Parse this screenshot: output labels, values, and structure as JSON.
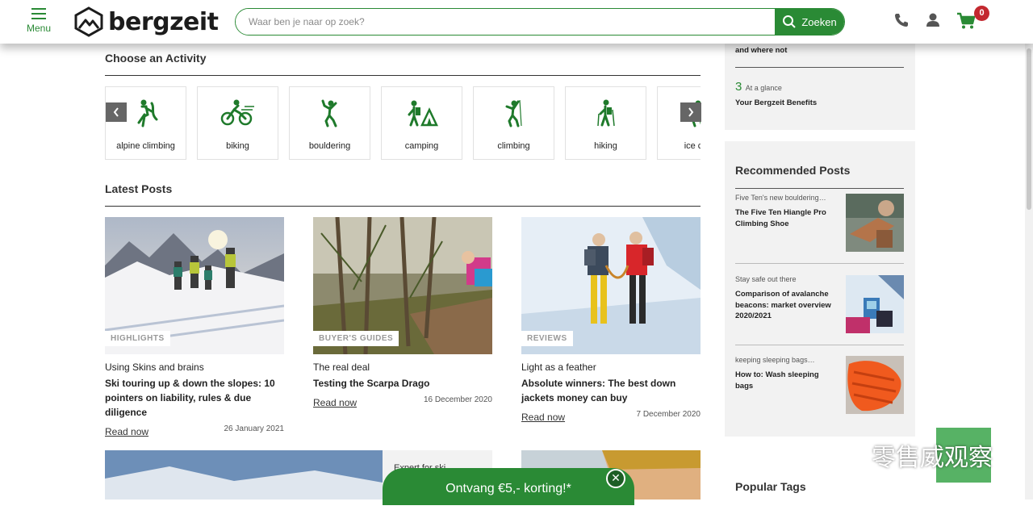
{
  "header": {
    "menu_label": "Menu",
    "logo_text": "bergzeit",
    "search_placeholder": "Waar ben je naar op zoek?",
    "search_button": "Zoeken",
    "cart_count": "0"
  },
  "activities": {
    "title": "Choose an Activity",
    "items": [
      {
        "label": "alpine climbing",
        "icon": "alpine-climbing-icon"
      },
      {
        "label": "biking",
        "icon": "biking-icon"
      },
      {
        "label": "bouldering",
        "icon": "bouldering-icon"
      },
      {
        "label": "camping",
        "icon": "camping-icon"
      },
      {
        "label": "climbing",
        "icon": "climbing-icon"
      },
      {
        "label": "hiking",
        "icon": "hiking-icon"
      },
      {
        "label": "ice clin",
        "icon": "ice-climbing-icon"
      }
    ]
  },
  "latest": {
    "title": "Latest Posts",
    "posts": [
      {
        "tag": "HIGHLIGHTS",
        "kicker": "Using Skins and brains",
        "title": "Ski touring up & down the slopes: 10 pointers on liability, rules & due diligence",
        "read": "Read now",
        "date": "26 January 2021"
      },
      {
        "tag": "BUYER'S GUIDES",
        "kicker": "The real deal",
        "title": "Testing the Scarpa Drago",
        "read": "Read now",
        "date": "16 December 2020"
      },
      {
        "tag": "REVIEWS",
        "kicker": "Light as a feather",
        "title": "Absolute winners: The best down jackets money can buy",
        "read": "Read now",
        "date": "7 December 2020"
      }
    ],
    "next_row_text": "Expert for ski"
  },
  "sidebar": {
    "benefit_tail": "and where not",
    "benefit_num": "3",
    "benefit_kicker": "At a glance",
    "benefit_title": "Your Bergzeit Benefits",
    "recommended_title": "Recommended Posts",
    "recommended": [
      {
        "kicker": "Five Ten's new bouldering…",
        "title": "The Five Ten Hiangle Pro Climbing Shoe"
      },
      {
        "kicker": "Stay safe out there",
        "title": "Comparison of avalanche beacons: market overview 2020/2021"
      },
      {
        "kicker": "keeping sleeping bags…",
        "title": "How to: Wash sleeping bags"
      }
    ],
    "popular_tags_title": "Popular Tags"
  },
  "promo": {
    "label": "Ontvang €5,- korting!*",
    "close": "✕"
  },
  "watermark": "零售威观察",
  "colors": {
    "brand_green": "#2a8a35",
    "badge_red": "#c3282f",
    "sidebar_bg": "#f2f2f2"
  }
}
